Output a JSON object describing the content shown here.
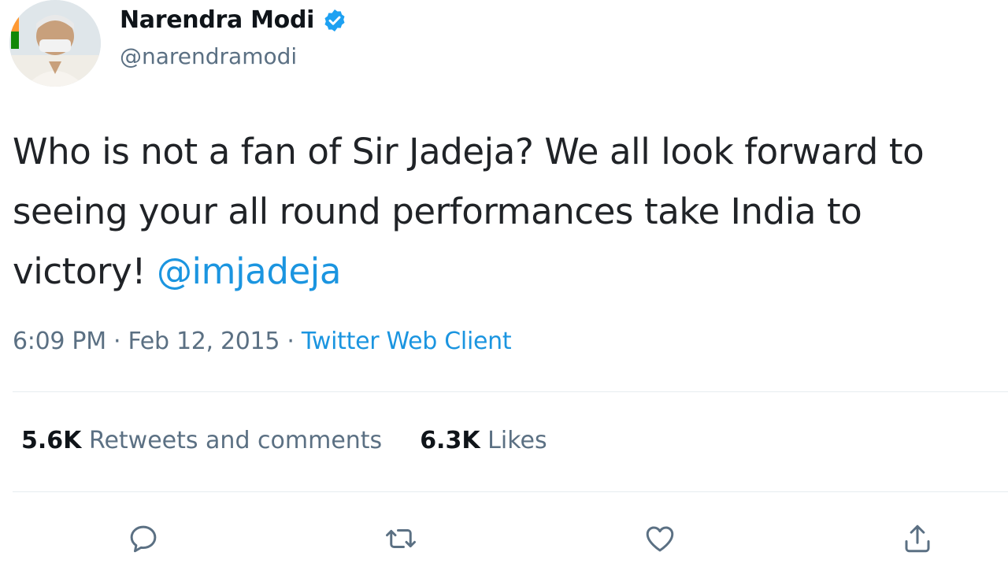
{
  "tweet": {
    "author": {
      "name": "Narendra Modi",
      "handle": "@narendramodi",
      "verified_icon": "verified-badge-icon"
    },
    "text_main": "Who is not a fan of Sir Jadeja? We all look forward to seeing your all round performances take India to victory! ",
    "mention": "@imjadeja",
    "time": "6:09 PM · Feb 12, 2015 · ",
    "source": "Twitter Web Client",
    "stats": {
      "retweets_count": "5.6K",
      "retweets_label": "Retweets and comments",
      "likes_count": "6.3K",
      "likes_label": "Likes"
    },
    "actions": [
      "reply-icon",
      "retweet-icon",
      "like-icon",
      "share-icon"
    ]
  },
  "colors": {
    "link": "#1b95e0",
    "secondary_text": "#5b7083",
    "verified": "#1da1f2"
  }
}
